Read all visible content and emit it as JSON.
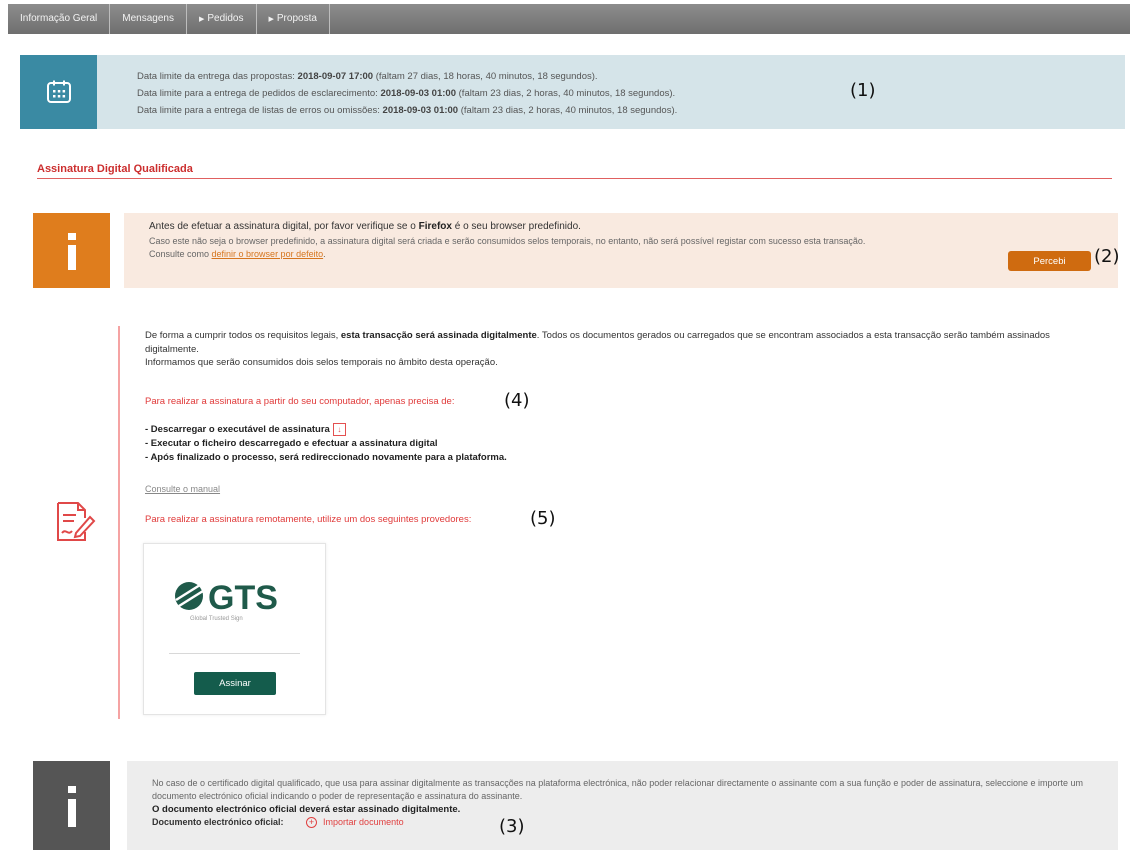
{
  "tabs": [
    {
      "label": "Informação Geral",
      "arrow": ""
    },
    {
      "label": "Mensagens",
      "arrow": ""
    },
    {
      "label": "Pedidos",
      "arrow": "▶"
    },
    {
      "label": "Proposta",
      "arrow": "▶"
    }
  ],
  "deadlines": {
    "line1_prefix": "Data limite da entrega das propostas: ",
    "line1_date": "2018-09-07 17:00",
    "line1_suffix": " (faltam 27 dias, 18 horas, 40 minutos, 18 segundos).",
    "line2_prefix": "Data limite para a entrega de pedidos de esclarecimento: ",
    "line2_date": "2018-09-03 01:00",
    "line2_suffix": " (faltam 23 dias, 2 horas, 40 minutos, 18 segundos).",
    "line3_prefix": "Data limite para a entrega de listas de erros ou omissões: ",
    "line3_date": "2018-09-03 01:00",
    "line3_suffix": " (faltam 23 dias, 2 horas, 40 minutos, 18 segundos)."
  },
  "annotations": {
    "a1": "(1)",
    "a2": "(2)",
    "a3": "(3)",
    "a4": "(4)",
    "a5": "(5)"
  },
  "section": {
    "title": "Assinatura Digital Qualificada"
  },
  "firefox_notice": {
    "lead_prefix": "Antes de efetuar a assinatura digital, por favor verifique se o ",
    "lead_bold": "Firefox",
    "lead_suffix": " é o seu browser predefinido.",
    "body": "Caso este não seja o browser predefinido, a assinatura digital será criada e serão consumidos selos temporais, no entanto, não será possível registar com sucesso esta transação.",
    "consult_prefix": "Consulte como ",
    "consult_link": "definir o browser por defeito",
    "consult_suffix": ".",
    "button": "Percebi"
  },
  "signature": {
    "intro_prefix": "De forma a cumprir todos os requisitos legais, ",
    "intro_bold": "esta transacção será assinada digitalmente",
    "intro_suffix": ". Todos os documentos gerados ou carregados que se encontram associados a esta transacção serão também assinados digitalmente.",
    "seals_note": "Informamos que serão consumidos dois selos temporais no âmbito desta operação.",
    "local_heading": "Para realizar a assinatura a partir do seu computador, apenas precisa de:",
    "step1": "- Descarregar o executável de assinatura",
    "step2": "- Executar o ficheiro descarregado e efectuar a assinatura digital",
    "step3": "- Após finalizado o processo, será redireccionado novamente para a plataforma.",
    "manual_link": "Consulte o manual",
    "remote_heading": "Para realizar a assinatura remotamente, utilize um dos seguintes provedores:"
  },
  "provider": {
    "logo_text": "GTS",
    "logo_subtitle": "Global Trusted Sign",
    "button": "Assinar",
    "brand_color": "#1f5a4a"
  },
  "certificate_notice": {
    "body": "No caso de o certificado digital qualificado, que usa para assinar digitalmente as transacções na plataforma electrónica, não poder relacionar directamente o assinante com a sua função e poder de assinatura, seleccione e importe um documento electrónico oficial indicando o poder de representação e assinatura do assinante.",
    "strong": "O documento electrónico oficial deverá estar assinado digitalmente.",
    "doc_label": "Documento electrónico oficial:",
    "import_link": "Importar documento"
  }
}
